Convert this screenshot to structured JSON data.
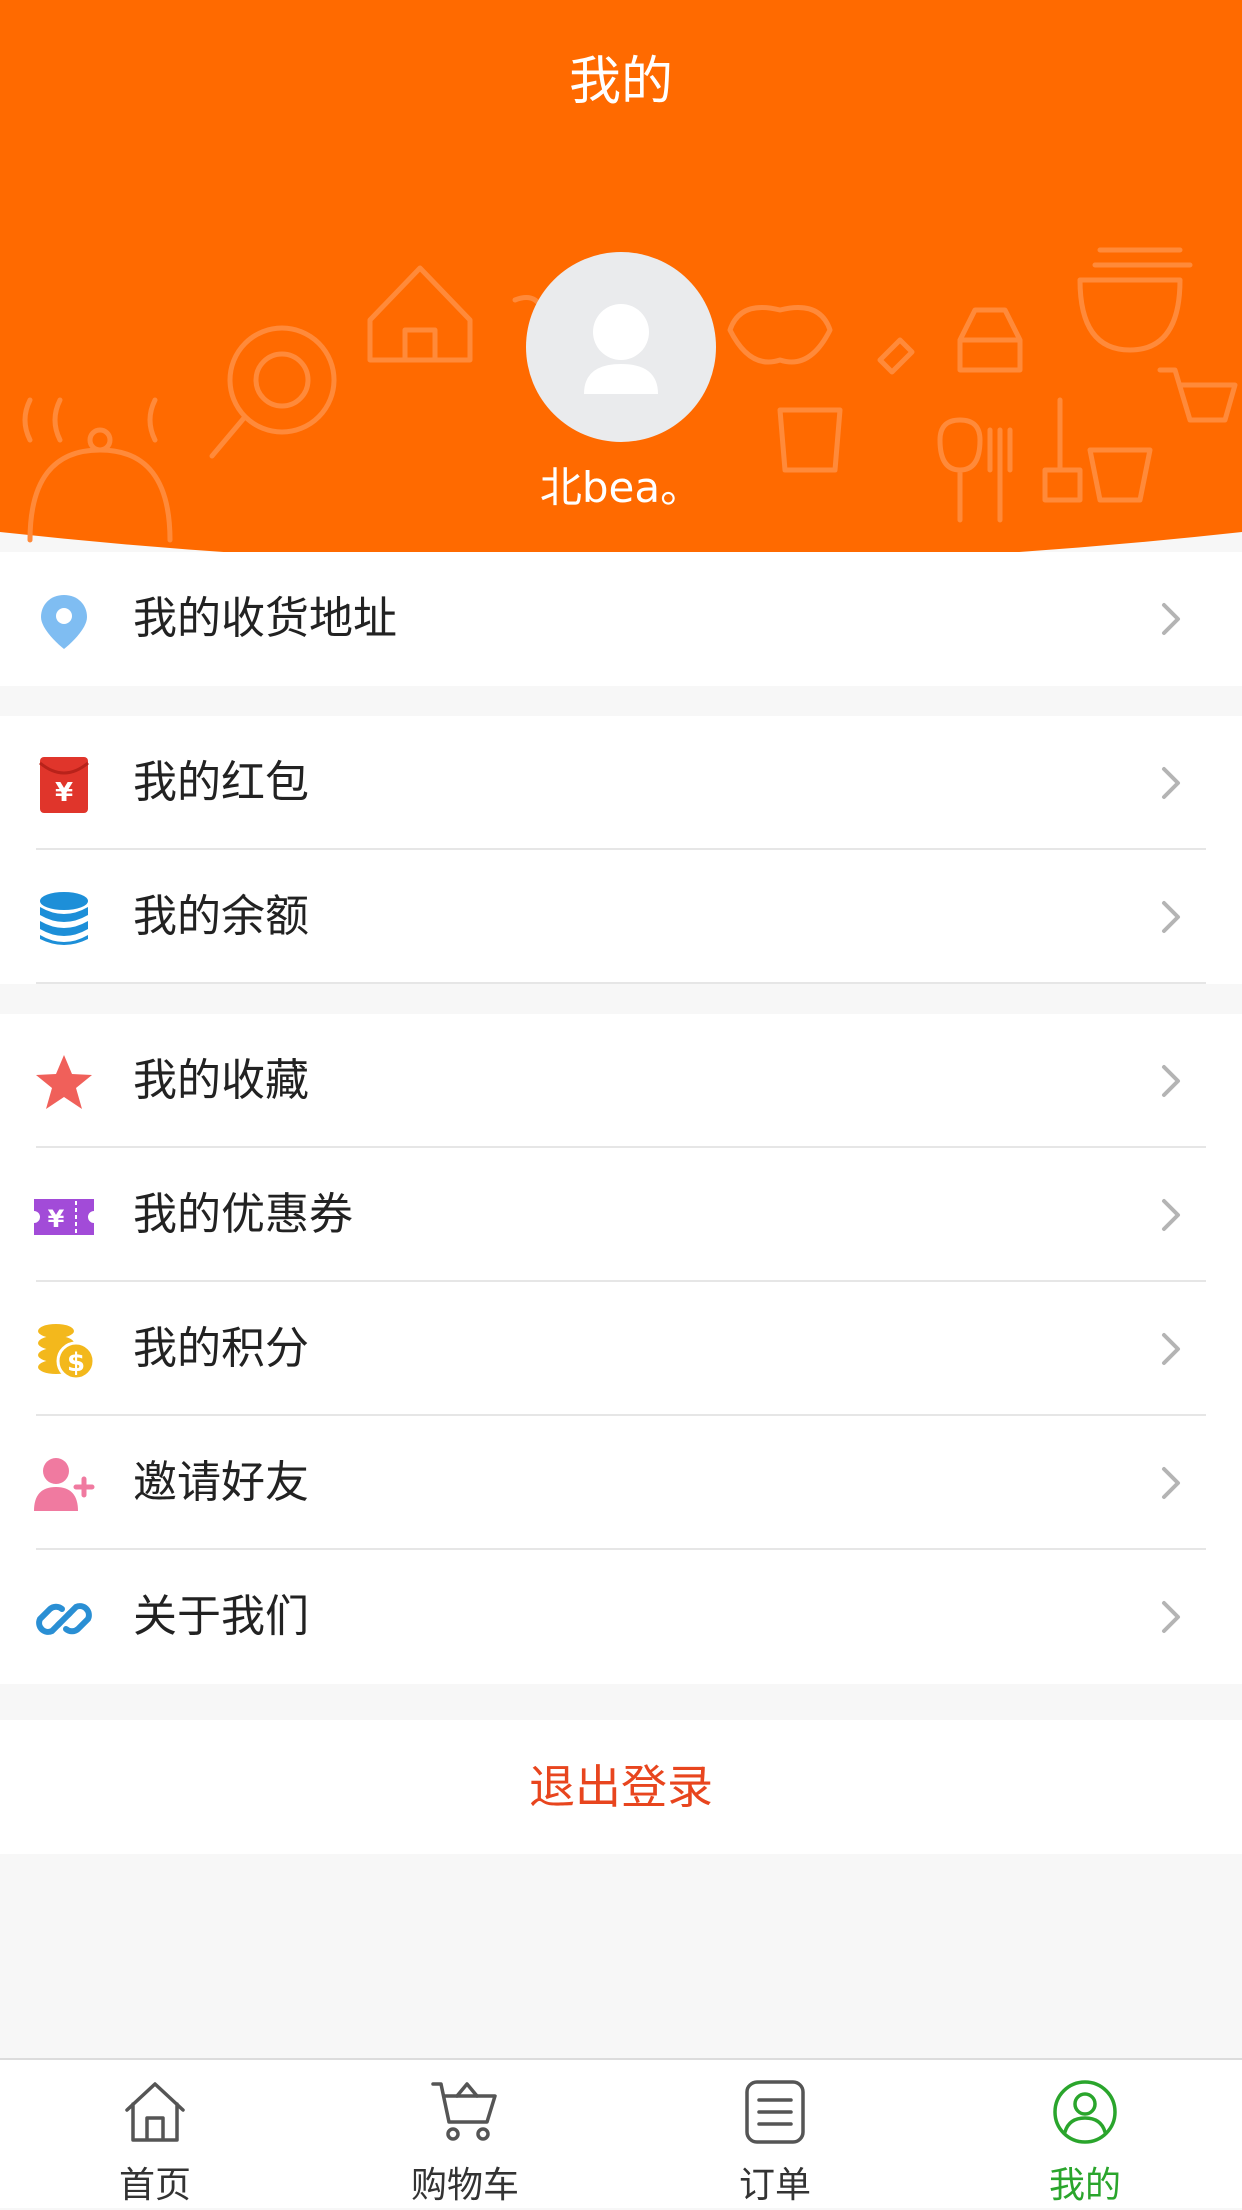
{
  "header": {
    "title": "我的",
    "username": "北bea。",
    "background_color": "#ff6a00"
  },
  "menu": {
    "address": {
      "label": "我的收货地址",
      "icon": "location-pin-icon"
    },
    "wallet": [
      {
        "label": "我的红包",
        "icon": "red-envelope-icon"
      },
      {
        "label": "我的余额",
        "icon": "balance-coins-icon"
      }
    ],
    "extras": [
      {
        "label": "我的收藏",
        "icon": "star-icon"
      },
      {
        "label": "我的优惠券",
        "icon": "coupon-icon"
      },
      {
        "label": "我的积分",
        "icon": "points-coins-icon"
      },
      {
        "label": "邀请好友",
        "icon": "invite-friend-icon"
      },
      {
        "label": "关于我们",
        "icon": "link-icon"
      }
    ]
  },
  "logout": {
    "label": "退出登录",
    "color": "#e8451e"
  },
  "tabbar": {
    "items": [
      {
        "label": "首页",
        "icon": "home-icon"
      },
      {
        "label": "购物车",
        "icon": "cart-icon"
      },
      {
        "label": "订单",
        "icon": "order-list-icon"
      },
      {
        "label": "我的",
        "icon": "profile-icon"
      }
    ],
    "active_index": 3,
    "active_color": "#2aa52c"
  }
}
